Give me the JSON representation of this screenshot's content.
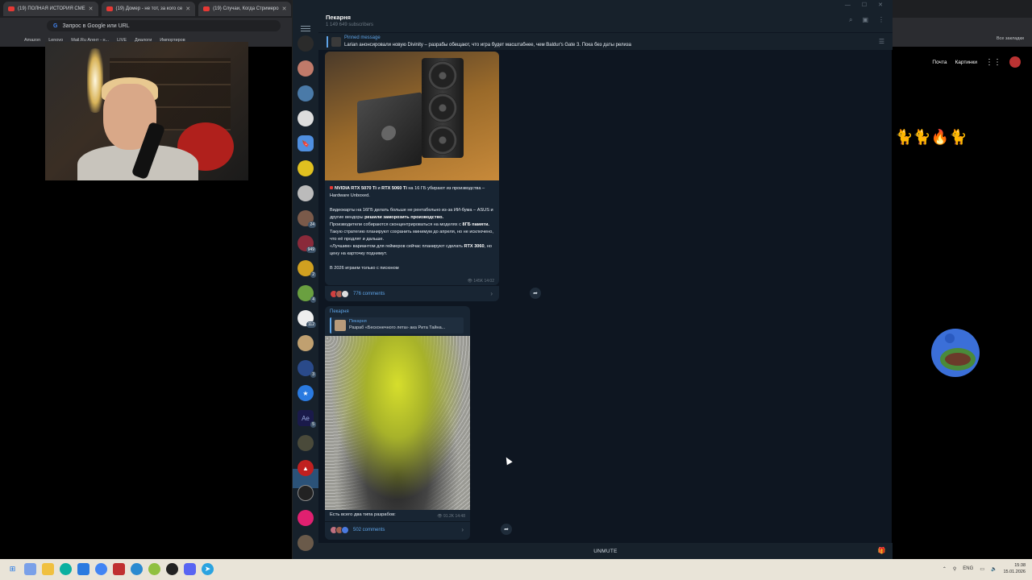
{
  "browser": {
    "tabs": [
      {
        "label": "(19) ПОЛНАЯ ИСТОРИЯ СМЕ"
      },
      {
        "label": "(19) Домер - не тот, за кого се"
      },
      {
        "label": "(19) Случаи, Когда Стримеро"
      }
    ],
    "address_placeholder": "Запрос в Google или URL",
    "bookmarks": [
      "Amazon",
      "Lenovo",
      "Mail.Ru Агент - н...",
      "LIVE",
      "Диалоги",
      "Импортиров"
    ],
    "all_bookmarks": "Все закладки",
    "right_links": [
      "Почта",
      "Картинки"
    ]
  },
  "telegram": {
    "channel_name": "Пекарня",
    "subscribers": "1 149 649 subscribers",
    "pinned": {
      "title": "Pinned message",
      "text": "Larian анонсировали новую Divinity – разрабы обещают, что игра будет масштабнее, чем Baldur's Gate 3. Пока без даты релиза"
    },
    "post1": {
      "headline_a": "NVIDIA RTX 5070 Ti",
      "headline_b": " и ",
      "headline_c": "RTX 5060 Ti",
      "headline_d": " на 16 ГБ убирают из производства – Hardware Unboxed.",
      "p1_a": "Видеокарты на 16ГБ делать больше не рентабельно из-за ИИ-бума – ASUS и другие вендоры ",
      "p1_b": "решили заморозить производство.",
      "p2_a": "Производители собираются сконцентрироваться на моделях с ",
      "p2_b": "8ГБ памяти.",
      "p3": "Такую стратегию планируют сохранить минимум до апреля, но не исключено, что её продлят и дальше.",
      "p4_a": "«Лучшим» вариантом для геймеров сейчас планируют сделать ",
      "p4_b": "RTX 3060",
      "p4_c": ", но цену на карточку поднимут.",
      "footer": "В 2026 играем только с писюном",
      "views": "145K",
      "time": "14:02",
      "comments": "776 comments"
    },
    "post2": {
      "author": "Пекарня",
      "reply_name": "Пекарня",
      "reply_text": "Разраб «Бесконечного лета» ака Рита Тайна...",
      "caption": "Есть всего два типа разрабов:",
      "views": "91.2K",
      "time": "14:48",
      "comments": "502 comments"
    },
    "unmute": "UNMUTE",
    "rail_badges": [
      "24",
      "949",
      "2",
      "4",
      "112",
      "3",
      "5"
    ]
  },
  "taskbar": {
    "lang": "ENG",
    "time": "15:38",
    "date": "15.01.2026"
  }
}
